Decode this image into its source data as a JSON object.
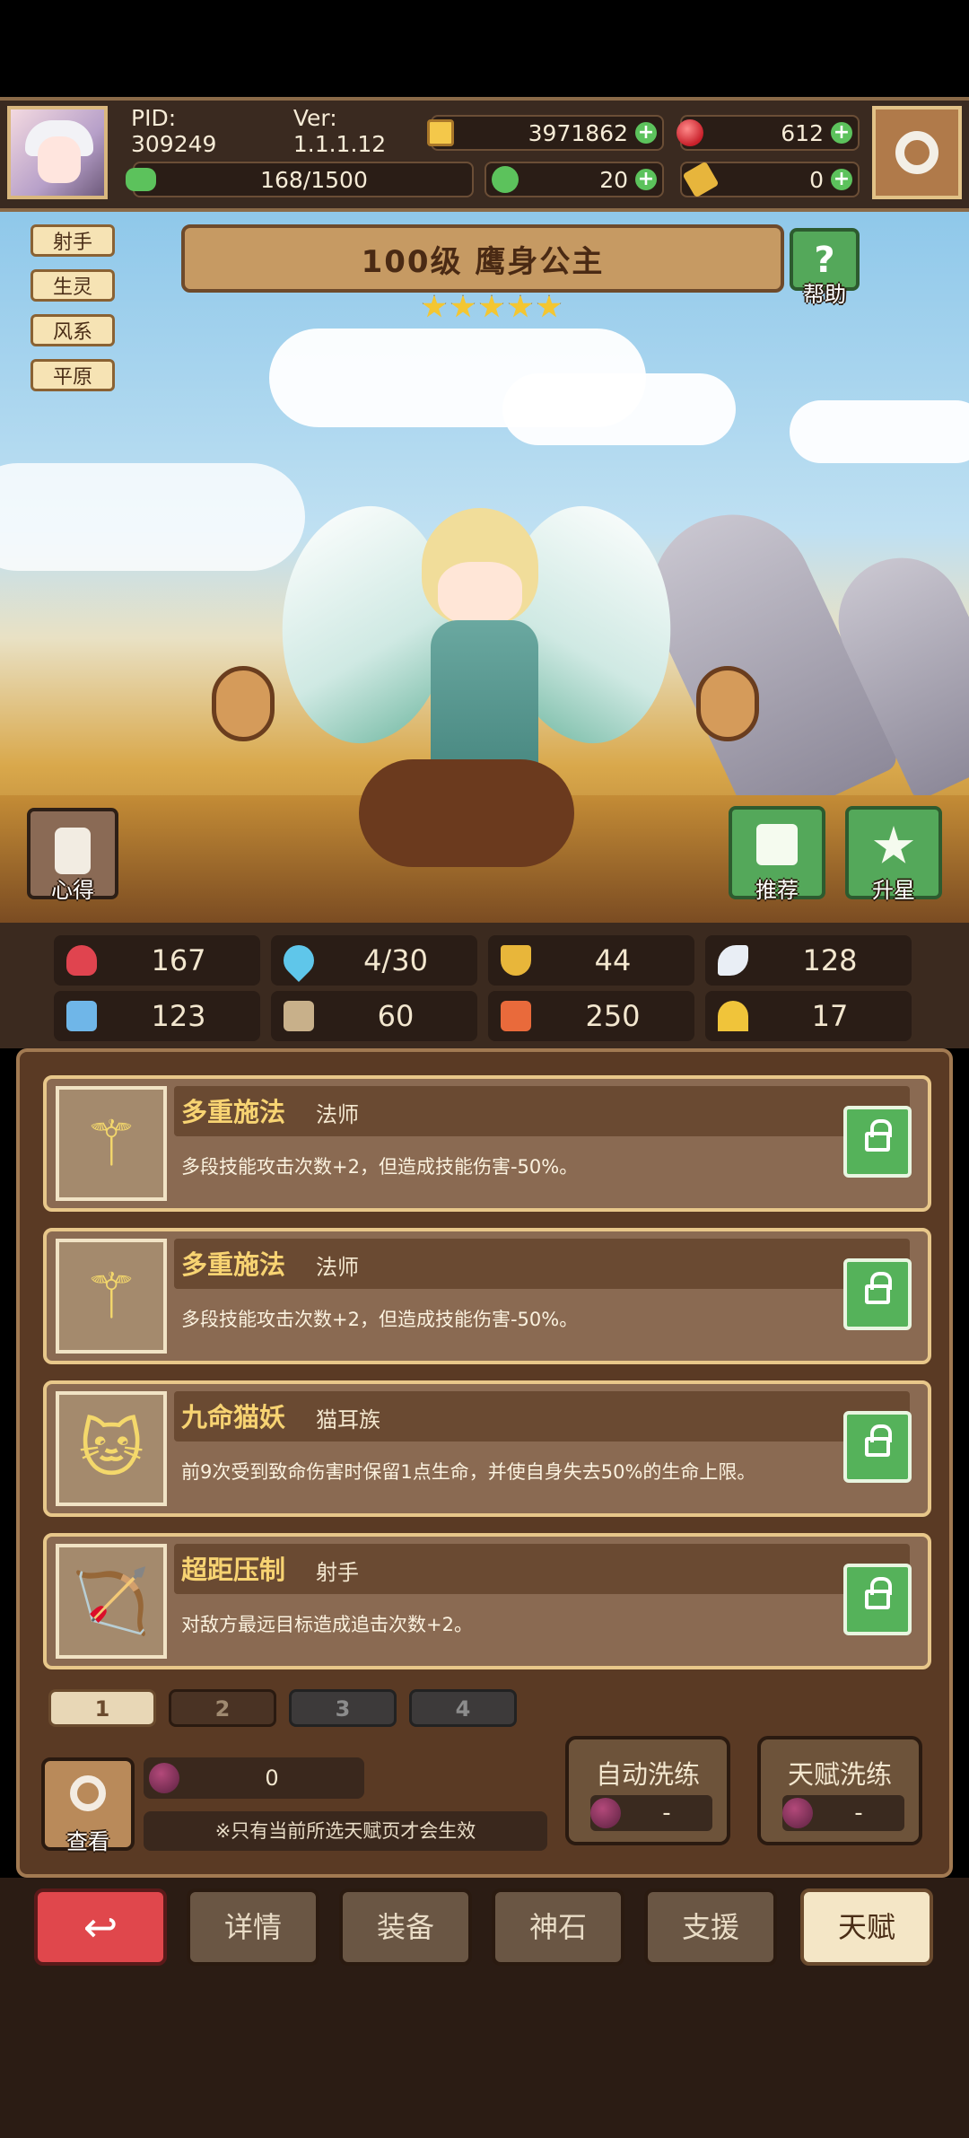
{
  "player": {
    "pid": "PID: 309249",
    "version": "Ver: 1.1.1.12",
    "gold": "3971862",
    "gems": "612",
    "energy": "168/1500",
    "clover": "20",
    "scroll": "0"
  },
  "hero": {
    "tags": [
      "射手",
      "生灵",
      "风系",
      "平原"
    ],
    "title": "100级  鹰身公主",
    "stars": 5,
    "help_label": "帮助",
    "notes_label": "心得",
    "recommend_label": "推荐",
    "starup_label": "升星"
  },
  "stats": [
    {
      "icon": "heart-icon",
      "value": "167",
      "color": "#e0444f"
    },
    {
      "icon": "water-drop-icon",
      "value": "4/30",
      "color": "#5fc6ea"
    },
    {
      "icon": "shield-icon",
      "value": "44",
      "color": "#e8b63a"
    },
    {
      "icon": "wing-icon",
      "value": "128",
      "color": "#e9eef5"
    },
    {
      "icon": "fist-icon",
      "value": "123",
      "color": "#6fb6e8"
    },
    {
      "icon": "book-icon",
      "value": "60",
      "color": "#c8b08a"
    },
    {
      "icon": "boot-icon",
      "value": "250",
      "color": "#e96a3b"
    },
    {
      "icon": "horseshoe-icon",
      "value": "17",
      "color": "#f0c43a"
    }
  ],
  "talents": [
    {
      "name": "多重施法",
      "class": "法师",
      "desc": "多段技能攻击次数+2，但造成技能伤害-50%。",
      "icon": "staff-icon",
      "glyph": "⚚"
    },
    {
      "name": "多重施法",
      "class": "法师",
      "desc": "多段技能攻击次数+2，但造成技能伤害-50%。",
      "icon": "staff-icon",
      "glyph": "⚚"
    },
    {
      "name": "九命猫妖",
      "class": "猫耳族",
      "desc": "前9次受到致命伤害时保留1点生命，并使自身失去50%的生命上限。",
      "icon": "cat-icon",
      "glyph": "🐱"
    },
    {
      "name": "超距压制",
      "class": "射手",
      "desc": "对敌方最远目标造成追击次数+2。",
      "icon": "bow-icon",
      "glyph": "🏹"
    }
  ],
  "pages": [
    "1",
    "2",
    "3",
    "4"
  ],
  "bottom": {
    "view_label": "查看",
    "fruit_count": "0",
    "note": "※只有当前所选天赋页才会生效",
    "auto_refine": "自动洗练",
    "auto_refine_cost": "-",
    "talent_refine": "天赋洗练",
    "talent_refine_cost": "-"
  },
  "nav": [
    "详情",
    "装备",
    "神石",
    "支援",
    "天赋"
  ]
}
